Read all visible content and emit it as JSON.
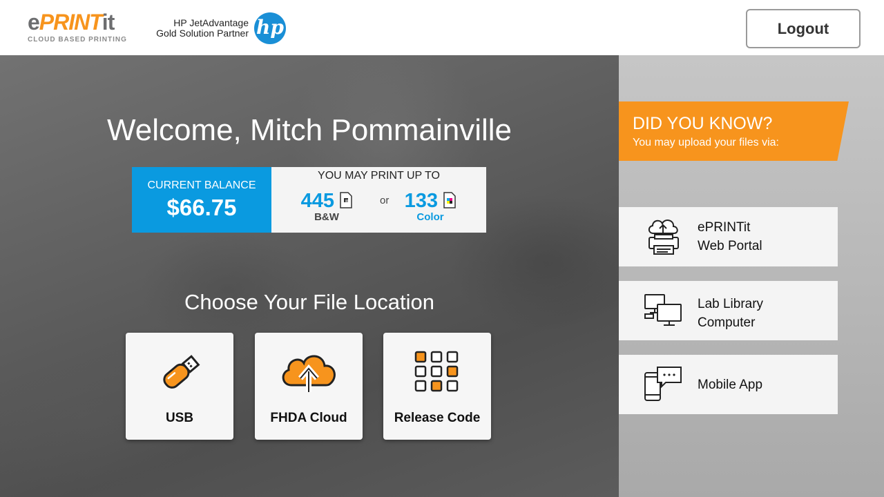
{
  "header": {
    "logo": {
      "part1": "e",
      "part2": "PRINT",
      "part3": "it",
      "tagline": "CLOUD BASED PRINTING"
    },
    "partner_line1": "HP JetAdvantage",
    "partner_line2": "Gold Solution Partner",
    "hp_logo_text": "hp",
    "logout_label": "Logout"
  },
  "main": {
    "welcome": "Welcome, Mitch Pommainville",
    "balance": {
      "label": "CURRENT BALANCE",
      "value": "$66.75",
      "print_up_to": "YOU MAY PRINT UP TO",
      "bw_count": "445",
      "bw_label": "B&W",
      "or": "or",
      "color_count": "133",
      "color_label": "Color"
    },
    "choose_title": "Choose Your File Location",
    "tiles": [
      {
        "label": "USB",
        "icon": "usb-drive-icon"
      },
      {
        "label": "FHDA Cloud",
        "icon": "cloud-upload-icon"
      },
      {
        "label": "Release Code",
        "icon": "keypad-icon"
      }
    ]
  },
  "sidebar": {
    "did_you_know": "DID YOU KNOW?",
    "did_you_know_sub": "You may upload your files via:",
    "items": [
      {
        "line1": "ePRINTit",
        "line2": "Web Portal",
        "icon": "cloud-printer-icon"
      },
      {
        "line1": "Lab Library",
        "line2": "Computer",
        "icon": "computers-icon"
      },
      {
        "line1": "Mobile App",
        "line2": "",
        "icon": "mobile-chat-icon"
      }
    ]
  },
  "colors": {
    "accent_orange": "#f7941d",
    "accent_blue": "#0a9ae0",
    "hp_blue": "#1a8fd6"
  }
}
